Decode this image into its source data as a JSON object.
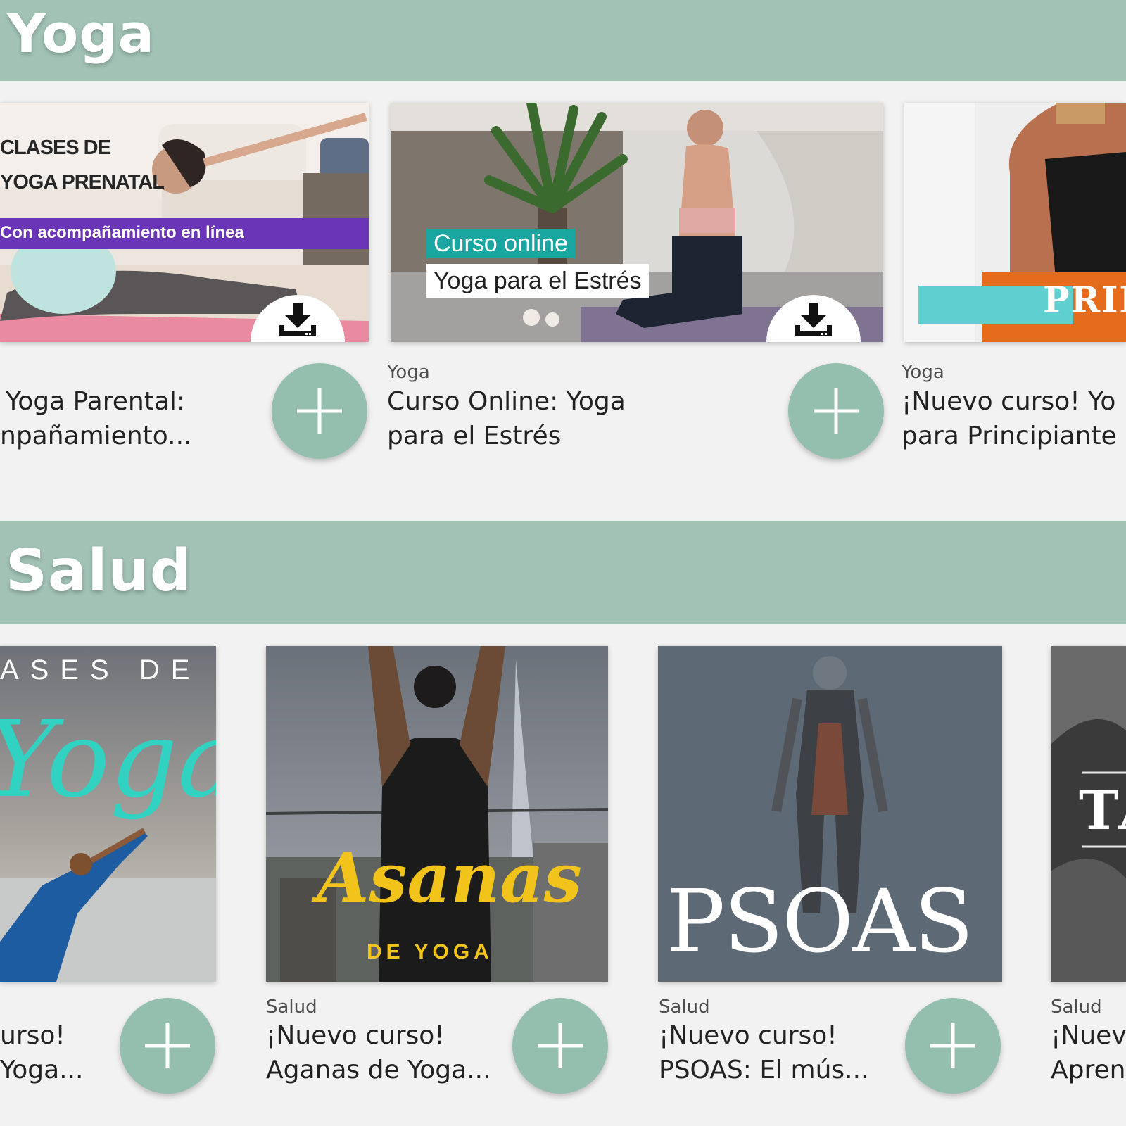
{
  "sections": {
    "yoga": {
      "title": "Yoga",
      "cards": [
        {
          "category": "",
          "title_line1": "Yoga Parental:",
          "title_line2": "npañamiento...",
          "overlay_line1": "CLASES DE",
          "overlay_line2": "YOGA PRENATAL",
          "banner": "Con acompañamiento en línea",
          "download_icon": "download-icon"
        },
        {
          "category": "Yoga",
          "title_line1": "Curso Online: Yoga",
          "title_line2": "para el Estrés",
          "chip_line1": "Curso online",
          "chip_line2": "Yoga para el Estrés",
          "download_icon": "download-icon"
        },
        {
          "category": "Yoga",
          "title_line1": "¡Nuevo curso! Yo",
          "title_line2": "para Principiante",
          "overlay": "PRIN"
        }
      ]
    },
    "salud": {
      "title": "Salud",
      "cards": [
        {
          "category": "",
          "title_line1": "urso!",
          "title_line2": "Yoga...",
          "overlay_top": "ASES DE",
          "overlay_script": "Yoga"
        },
        {
          "category": "Salud",
          "title_line1": "¡Nuevo curso!",
          "title_line2": "Aganas de Yoga...",
          "overlay_script": "Asanas",
          "overlay_sub": "DE YOGA"
        },
        {
          "category": "Salud",
          "title_line1": "¡Nuevo curso!",
          "title_line2": "PSOAS: El mús...",
          "overlay": "PSOAS"
        },
        {
          "category": "Salud",
          "title_line1": "¡Nuev",
          "title_line2": "Apren",
          "overlay": "TA"
        }
      ]
    }
  },
  "colors": {
    "section_bar": "#a1c2b5",
    "add_button": "#94bfae",
    "page_bg": "#f2f2f2",
    "banner_purple": "#6a35b7",
    "chip_teal": "#1aa6a0",
    "script_teal": "#32d2c3",
    "script_yellow": "#f2c41b",
    "psoas_bg": "#5d6a75"
  },
  "icons": {
    "add": "plus-icon",
    "download": "download-icon"
  }
}
